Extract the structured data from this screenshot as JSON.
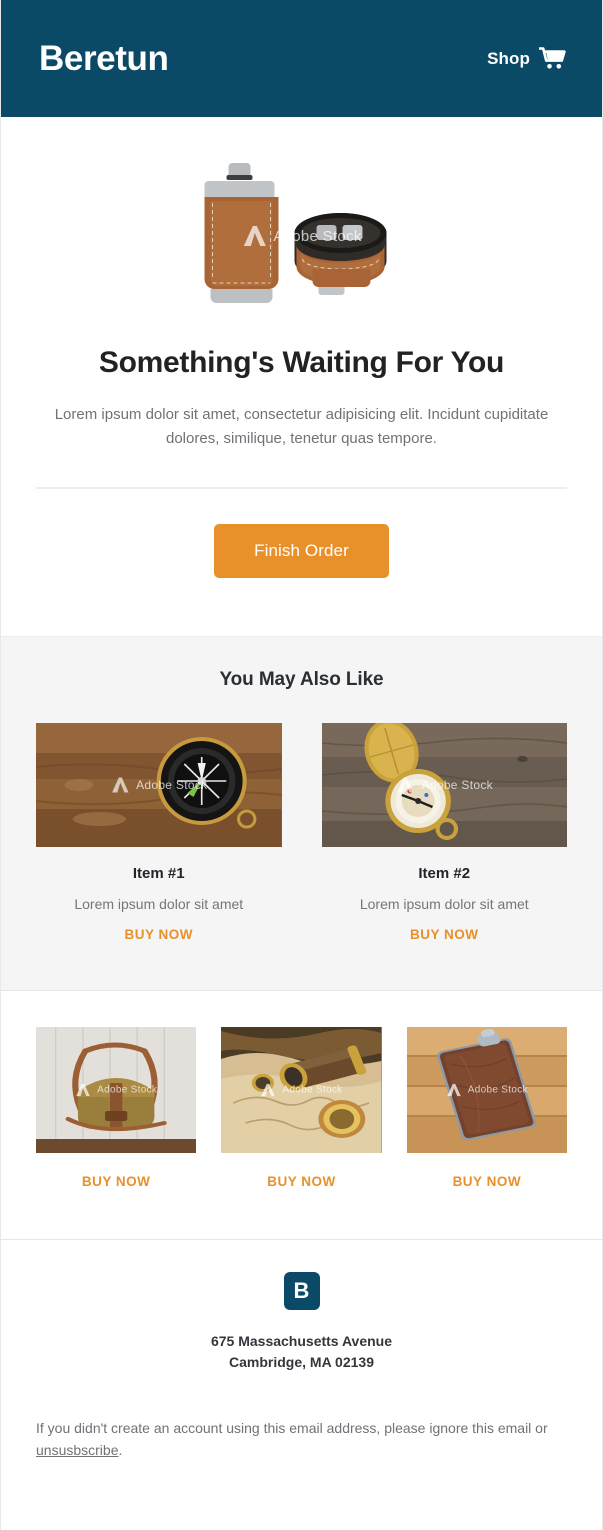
{
  "header": {
    "brand": "Beretun",
    "shop_label": "Shop",
    "cart_icon": "shopping-cart-icon",
    "background_color": "#0A4A66"
  },
  "hero": {
    "image_alt": "leather-flask-set",
    "watermark": "Adobe Stock",
    "title": "Something's Waiting For You",
    "body": "Lorem ipsum dolor sit amet, consectetur adipisicing elit. Incidunt cupiditate dolores, similique, tenetur quas tempore.",
    "cta_label": "Finish Order",
    "cta_color": "#E8912B"
  },
  "suggestions": {
    "title": "You May Also Like",
    "background_color": "#F5F5F5",
    "items": [
      {
        "image_alt": "black-compass-on-wood",
        "watermark": "Adobe Stock",
        "name": "Item #1",
        "description": "Lorem ipsum dolor sit amet",
        "buy_label": "BUY NOW"
      },
      {
        "image_alt": "brass-pocket-compass-on-wood",
        "watermark": "Adobe Stock",
        "name": "Item #2",
        "description": "Lorem ipsum dolor sit amet",
        "buy_label": "BUY NOW"
      }
    ]
  },
  "gallery": {
    "items": [
      {
        "image_alt": "leather-satchel-bag",
        "watermark": "Adobe Stock",
        "buy_label": "BUY NOW"
      },
      {
        "image_alt": "telescope-and-map",
        "watermark": "Adobe Stock",
        "buy_label": "BUY NOW"
      },
      {
        "image_alt": "brown-leather-flask",
        "watermark": "Adobe Stock",
        "buy_label": "BUY NOW"
      }
    ]
  },
  "footer": {
    "badge_letter": "B",
    "address_line1": "675 Massachusetts Avenue",
    "address_line2": "Cambridge, MA 02139",
    "note_prefix": "If you didn't create an account using this email address, please ignore this email or ",
    "unsubscribe_label": "unsusbscribe",
    "note_suffix": "."
  }
}
